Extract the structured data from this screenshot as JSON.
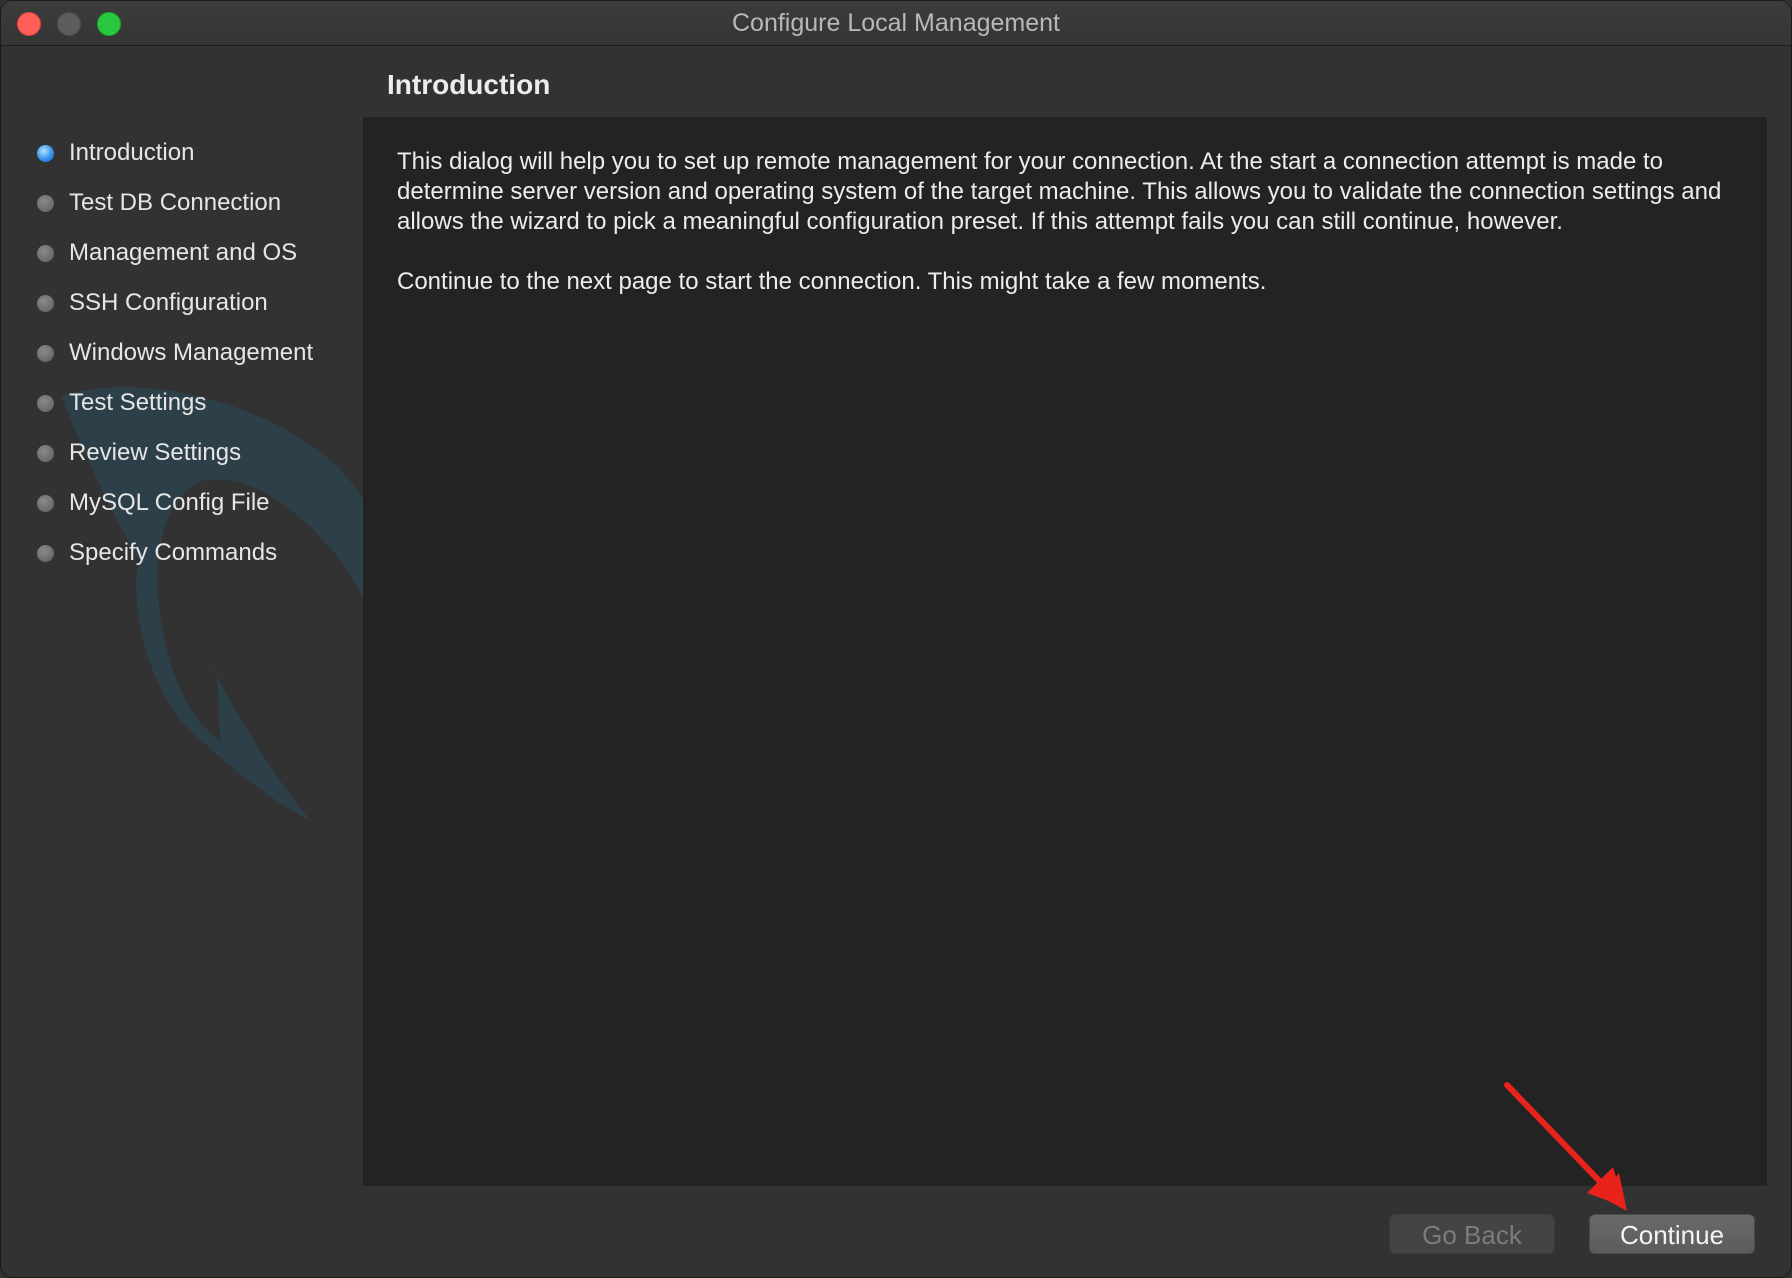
{
  "window": {
    "title": "Configure Local Management"
  },
  "sidebar": {
    "steps": [
      {
        "label": "Introduction",
        "active": true
      },
      {
        "label": "Test DB Connection",
        "active": false
      },
      {
        "label": "Management and OS",
        "active": false
      },
      {
        "label": "SSH Configuration",
        "active": false
      },
      {
        "label": "Windows Management",
        "active": false
      },
      {
        "label": "Test Settings",
        "active": false
      },
      {
        "label": "Review Settings",
        "active": false
      },
      {
        "label": "MySQL Config File",
        "active": false
      },
      {
        "label": "Specify Commands",
        "active": false
      }
    ]
  },
  "main": {
    "heading": "Introduction",
    "paragraphs": [
      "This dialog will help you to set up remote management for your connection. At the start a connection attempt is made to determine server version and operating system of the target machine. This allows you to validate the connection settings and allows the wizard to pick a meaningful configuration preset. If this attempt fails you can still continue, however.",
      "Continue to the next page to start the connection. This might take a few moments."
    ]
  },
  "footer": {
    "back_label": "Go Back",
    "continue_label": "Continue"
  },
  "colors": {
    "close": "#fe5f57",
    "minimize": "#5d5d5d",
    "zoom": "#28c840",
    "active_step": "#2f8be8",
    "annotation": "#e8231c"
  }
}
